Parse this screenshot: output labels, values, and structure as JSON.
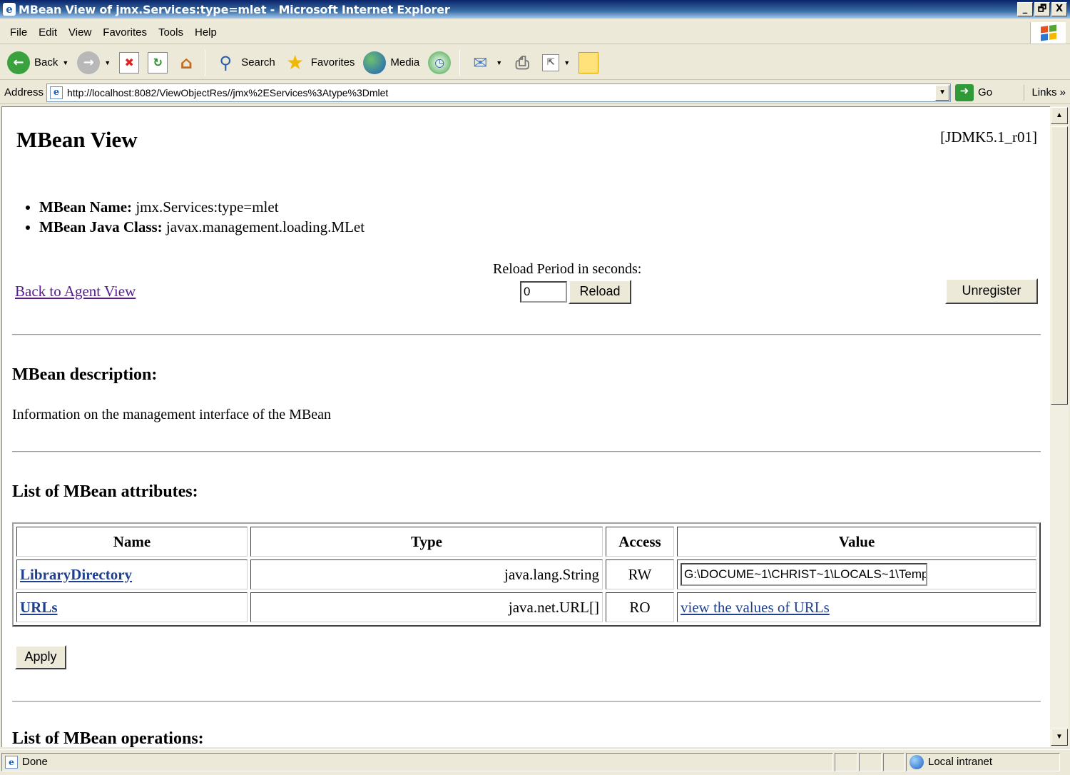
{
  "window": {
    "title": "MBean View of jmx.Services:type=mlet - Microsoft Internet Explorer",
    "controls": {
      "minimize": "_",
      "maximize": "🗗",
      "close": "X"
    }
  },
  "menu": [
    "File",
    "Edit",
    "View",
    "Favorites",
    "Tools",
    "Help"
  ],
  "toolbar": {
    "back_label": "Back",
    "search_label": "Search",
    "favorites_label": "Favorites",
    "media_label": "Media"
  },
  "address": {
    "label": "Address",
    "url": "http://localhost:8082/ViewObjectRes//jmx%2EServices%3Atype%3Dmlet",
    "go_label": "Go",
    "links_label": "Links"
  },
  "page": {
    "title": "MBean View",
    "version": "[JDMK5.1_r01]",
    "info": [
      {
        "label": "MBean Name:",
        "value": "jmx.Services:type=mlet"
      },
      {
        "label": "MBean Java Class:",
        "value": "javax.management.loading.MLet"
      }
    ],
    "reload_label": "Reload Period in seconds:",
    "reload_value": "0",
    "reload_button": "Reload",
    "back_link": "Back to Agent View",
    "unregister_button": "Unregister",
    "description_heading": "MBean description:",
    "description": "Information on the management interface of the MBean",
    "attributes_heading": "List of MBean attributes:",
    "attributes_columns": [
      "Name",
      "Type",
      "Access",
      "Value"
    ],
    "attributes": [
      {
        "name": "LibraryDirectory",
        "type": "java.lang.String",
        "access": "RW",
        "value": "G:\\DOCUME~1\\CHRIST~1\\LOCALS~1\\Temp"
      },
      {
        "name": "URLs",
        "type": "java.net.URL[]",
        "access": "RO",
        "value": "view the values of URLs"
      }
    ],
    "apply_button": "Apply",
    "operations_heading": "List of MBean operations:"
  },
  "status": {
    "text": "Done",
    "zone": "Local intranet"
  }
}
